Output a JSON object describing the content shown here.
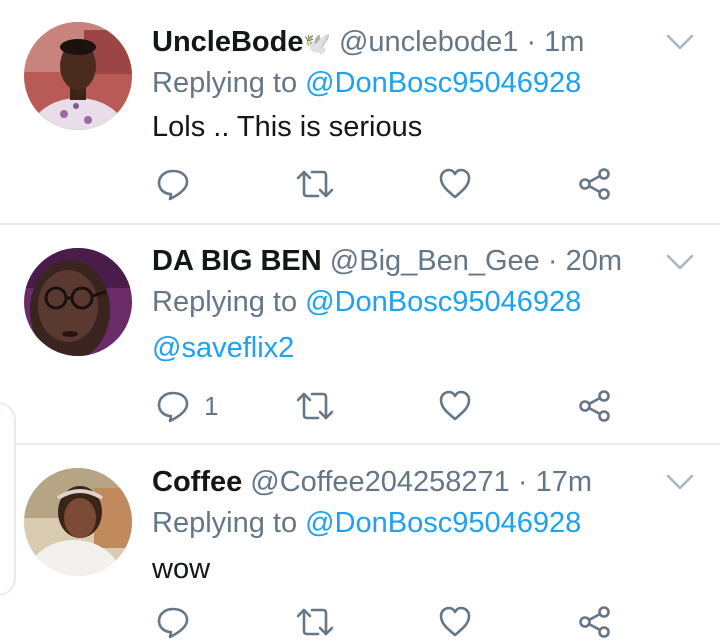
{
  "tweets": [
    {
      "name": "UncleBode",
      "name_emoji": "🕊️",
      "handle": "@unclebode1",
      "separator": "·",
      "time": "1m",
      "replying_prefix": "Replying to",
      "replying_to": "@DonBosc95046928",
      "text": "Lols .. This is serious",
      "reply_count": "",
      "avatar_bg": "#b85a55"
    },
    {
      "name": "DA BIG BEN",
      "handle": "@Big_Ben_Gee",
      "separator": "·",
      "time": "20m",
      "replying_prefix": "Replying to",
      "replying_to": "@DonBosc95046928",
      "text": "@saveflix2",
      "reply_count": "1",
      "avatar_bg": "#6b2a68"
    },
    {
      "name": "Coffee",
      "handle": "@Coffee204258271",
      "separator": "·",
      "time": "17m",
      "replying_prefix": "Replying to",
      "replying_to": "@DonBosc95046928",
      "text": "wow",
      "reply_count": "",
      "avatar_bg": "#c9b89a"
    }
  ],
  "colors": {
    "link": "#1da1f2",
    "secondary": "#657786",
    "divider": "#e6ecf0"
  },
  "icons": [
    "reply-icon",
    "retweet-icon",
    "like-icon",
    "share-icon",
    "chevron-down-icon"
  ]
}
